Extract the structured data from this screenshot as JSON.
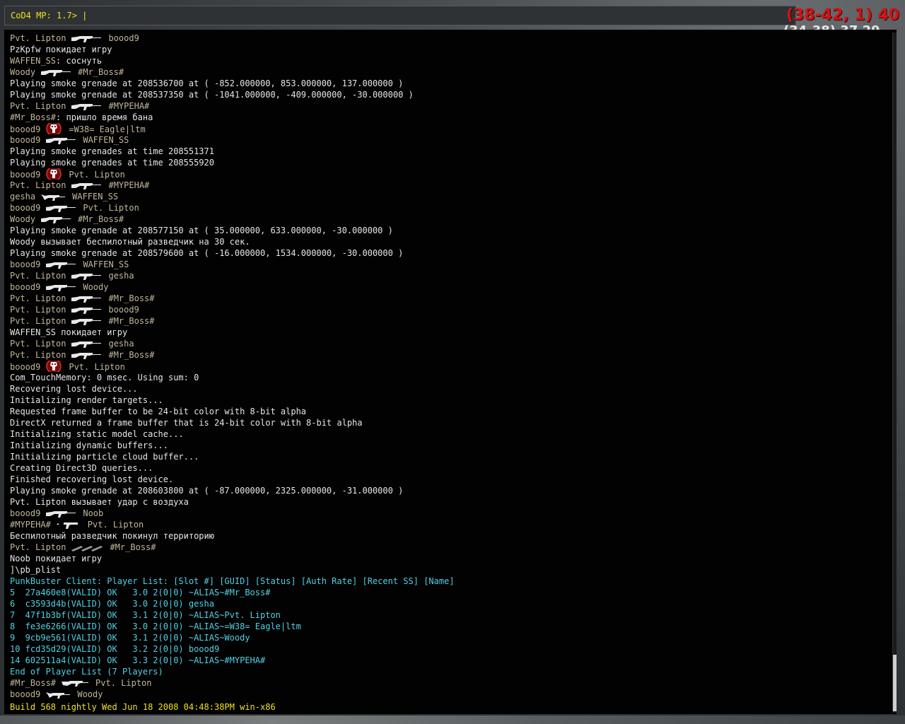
{
  "console": {
    "prompt": "CoD4 MP: 1.7> ",
    "cursor": "|"
  },
  "hud": {
    "red_text": "(38-42, 1) 40",
    "white_text": "(34-38) 37 29"
  },
  "log": [
    {
      "type": "kill",
      "killer": "Pvt. Lipton",
      "weapon": "rifle-icon",
      "victim": "boood9"
    },
    {
      "type": "text",
      "text": "PzKpfw покидает игру"
    },
    {
      "type": "chat",
      "name": "WAFFEN_SS",
      "text": ": соснуть"
    },
    {
      "type": "kill",
      "killer": "Woody",
      "weapon": "rifle-icon",
      "victim": "#Mr_Boss#"
    },
    {
      "type": "text",
      "text": "Playing smoke grenade at 208536700 at ( -852.000000, 853.000000, 137.000000 )"
    },
    {
      "type": "text",
      "text": "Playing smoke grenade at 208537350 at ( -1041.000000, -409.000000, -30.000000 )"
    },
    {
      "type": "kill",
      "killer": "Pvt. Lipton",
      "weapon": "rifle-icon",
      "victim": "#MYPEHA#"
    },
    {
      "type": "chat",
      "name": "#Mr_Boss#",
      "text": ": пришло время бана"
    },
    {
      "type": "kill",
      "killer": "boood9",
      "weapon": "skull-icon",
      "victim": "=W38= Eagle|ltm"
    },
    {
      "type": "kill",
      "killer": "boood9",
      "weapon": "rifle-icon",
      "victim": "WAFFEN_SS"
    },
    {
      "type": "text",
      "text": "Playing smoke grenades at time 208551371"
    },
    {
      "type": "text",
      "text": "Playing smoke grenades at time 208555920"
    },
    {
      "type": "kill",
      "killer": "boood9",
      "weapon": "skull-icon",
      "victim": "Pvt. Lipton"
    },
    {
      "type": "kill",
      "killer": "Pvt. Lipton",
      "weapon": "rifle-icon",
      "victim": "#MYPEHA#"
    },
    {
      "type": "kill",
      "killer": "gesha",
      "weapon": "smg-icon",
      "victim": "WAFFEN_SS"
    },
    {
      "type": "kill",
      "killer": "boood9",
      "weapon": "rifle-icon",
      "victim": "Pvt. Lipton"
    },
    {
      "type": "kill",
      "killer": "Woody",
      "weapon": "rifle-icon",
      "victim": "#Mr_Boss#"
    },
    {
      "type": "text",
      "text": "Playing smoke grenade at 208577150 at ( 35.000000, 633.000000, -30.000000 )"
    },
    {
      "type": "text",
      "text": "Woody вызывает беспилотный разведчик на 30 сек."
    },
    {
      "type": "text",
      "text": "Playing smoke grenade at 208579600 at ( -16.000000, 1534.000000, -30.000000 )"
    },
    {
      "type": "kill",
      "killer": "boood9",
      "weapon": "rifle-icon",
      "victim": "WAFFEN_SS"
    },
    {
      "type": "kill",
      "killer": "Pvt. Lipton",
      "weapon": "rifle-icon",
      "victim": "gesha"
    },
    {
      "type": "kill",
      "killer": "boood9",
      "weapon": "rifle-icon",
      "victim": "Woody"
    },
    {
      "type": "kill",
      "killer": "Pvt. Lipton",
      "weapon": "rifle-icon",
      "victim": "#Mr_Boss#"
    },
    {
      "type": "kill",
      "killer": "Pvt. Lipton",
      "weapon": "rifle-icon",
      "victim": "boood9"
    },
    {
      "type": "kill",
      "killer": "Pvt. Lipton",
      "weapon": "rifle-icon",
      "victim": "#Mr_Boss#"
    },
    {
      "type": "text",
      "text": "WAFFEN_SS покидает игру"
    },
    {
      "type": "kill",
      "killer": "Pvt. Lipton",
      "weapon": "rifle-icon",
      "victim": "gesha"
    },
    {
      "type": "kill",
      "killer": "Pvt. Lipton",
      "weapon": "rifle-icon",
      "victim": "#Mr_Boss#"
    },
    {
      "type": "kill",
      "killer": "boood9",
      "weapon": "skull-icon",
      "victim": "Pvt. Lipton"
    },
    {
      "type": "text",
      "text": "Com_TouchMemory: 0 msec. Using sum: 0"
    },
    {
      "type": "text",
      "text": "Recovering lost device..."
    },
    {
      "type": "text",
      "text": "Initializing render targets..."
    },
    {
      "type": "text",
      "text": "Requested frame buffer to be 24-bit color with 8-bit alpha"
    },
    {
      "type": "text",
      "text": "DirectX returned a frame buffer that is 24-bit color with 8-bit alpha"
    },
    {
      "type": "text",
      "text": "Initializing static model cache..."
    },
    {
      "type": "text",
      "text": "Initializing dynamic buffers..."
    },
    {
      "type": "text",
      "text": "Initializing particle cloud buffer..."
    },
    {
      "type": "text",
      "text": "Creating Direct3D queries..."
    },
    {
      "type": "text",
      "text": "Finished recovering lost device."
    },
    {
      "type": "text",
      "text": "Playing smoke grenade at 208603800 at ( -87.000000, 2325.000000, -31.000000 )"
    },
    {
      "type": "text",
      "text": "Pvt. Lipton вызывает удар с воздуха"
    },
    {
      "type": "kill",
      "killer": "boood9",
      "weapon": "rifle-icon",
      "victim": "Noob"
    },
    {
      "type": "kill",
      "killer": "#MYPEHA#",
      "weapon": "pistol-icon",
      "victim": "Pvt. Lipton"
    },
    {
      "type": "text",
      "text": "Беспилотный разведчик покинул территорию"
    },
    {
      "type": "kill",
      "killer": "Pvt. Lipton",
      "weapon": "airstrike-icon",
      "victim": "#Mr_Boss#"
    },
    {
      "type": "text",
      "text": "Noob покидает игру"
    },
    {
      "type": "text",
      "text": "]\\pb_plist"
    },
    {
      "type": "pb",
      "text": "PunkBuster Client: Player List: [Slot #] [GUID] [Status] [Auth Rate] [Recent SS] [Name]"
    },
    {
      "type": "pb",
      "text": "5  27a460e8(VALID) OK   3.0 2(0|0) ~ALIAS~#Mr_Boss#"
    },
    {
      "type": "pb",
      "text": "6  c3593d4b(VALID) OK   3.0 2(0|0) gesha"
    },
    {
      "type": "pb",
      "text": "7  47f1b3bf(VALID) OK   3.1 2(0|0) ~ALIAS~Pvt. Lipton"
    },
    {
      "type": "pb",
      "text": "8  fe3e6266(VALID) OK   3.0 2(0|0) ~ALIAS~=W38= Eagle|ltm"
    },
    {
      "type": "pb",
      "text": "9  9cb9e561(VALID) OK   3.1 2(0|0) ~ALIAS~Woody"
    },
    {
      "type": "pb",
      "text": "10 fcd35d29(VALID) OK   3.2 2(0|0) boood9"
    },
    {
      "type": "pb",
      "text": "14 602511a4(VALID) OK   3.3 2(0|0) ~ALIAS~#MYPEHA#"
    },
    {
      "type": "pb",
      "text": "End of Player List (7 Players)"
    },
    {
      "type": "kill",
      "killer": "#Mr_Boss#",
      "weapon": "ak-icon",
      "victim": "Pvt. Lipton"
    },
    {
      "type": "kill",
      "killer": "boood9",
      "weapon": "smg-icon",
      "victim": "Woody"
    }
  ],
  "build": "Build 568 nightly Wed Jun 18 2008 04:48:38PM win-x86",
  "colors": {
    "input_text": "#f0e020",
    "punkbuster": "#4fd0e4",
    "player_name": "#c2b59a",
    "hud_red": "#d01414"
  }
}
